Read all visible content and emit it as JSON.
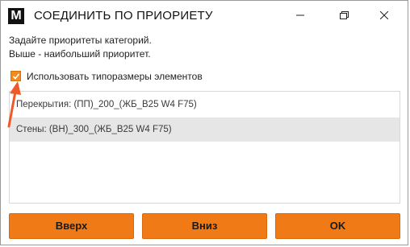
{
  "window": {
    "title": "СОЕДИНИТЬ ПО ПРИОРИЕТУ",
    "logo_letter": "M",
    "controls": [
      "minimize-icon",
      "maximize-icon",
      "close-icon"
    ]
  },
  "description": {
    "line1": "Задайте приоритеты категорий.",
    "line2": "Выше - наибольший приоритет."
  },
  "checkbox": {
    "label": "Использовать типоразмеры элементов",
    "checked": true
  },
  "list": {
    "items": [
      {
        "label": "Перекрытия: (ПП)_200_(ЖБ_B25 W4 F75)",
        "selected": false
      },
      {
        "label": "Стены: (ВН)_300_(ЖБ_B25 W4 F75)",
        "selected": true
      }
    ]
  },
  "buttons": {
    "up": "Вверх",
    "down": "Вниз",
    "ok": "OK"
  },
  "colors": {
    "accent": "#f07b16",
    "annotation_arrow": "#f05a28",
    "selected_row": "#e6e6e6"
  }
}
